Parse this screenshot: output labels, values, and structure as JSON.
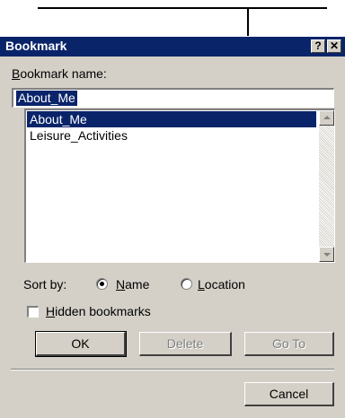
{
  "dialog": {
    "title": "Bookmark",
    "help_glyph": "?",
    "close_glyph": "✕"
  },
  "name_field": {
    "label": "Bookmark name:",
    "label_first": "B",
    "label_rest": "ookmark name:",
    "value": "About_Me"
  },
  "bookmark_list": {
    "items": [
      "About_Me",
      "Leisure_Activities"
    ],
    "selected": "About_Me"
  },
  "sort": {
    "label": "Sort by:",
    "options": [
      {
        "first": "N",
        "rest": "ame",
        "label": "Name",
        "checked": true
      },
      {
        "first": "L",
        "rest": "ocation",
        "label": "Location",
        "checked": false
      }
    ]
  },
  "hidden": {
    "label": "Hidden bookmarks",
    "first": "H",
    "rest": "idden bookmarks",
    "checked": false
  },
  "buttons": {
    "ok": "OK",
    "delete": "Delete",
    "goto": "Go To",
    "cancel": "Cancel"
  }
}
